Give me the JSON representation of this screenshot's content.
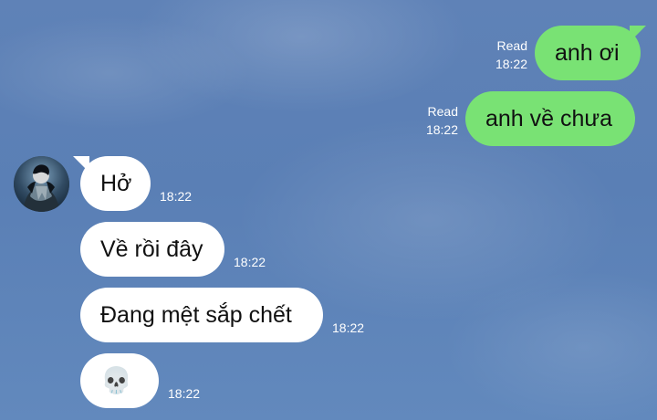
{
  "messages": {
    "outgoing": [
      {
        "status": "Read",
        "time": "18:22",
        "text": "anh ơi"
      },
      {
        "status": "Read",
        "time": "18:22",
        "text": "anh về chưa"
      }
    ],
    "incoming": [
      {
        "time": "18:22",
        "text": "Hở"
      },
      {
        "time": "18:22",
        "text": "Về rồi đây"
      },
      {
        "time": "18:22",
        "text": "Đang mệt sắp chết"
      },
      {
        "time": "18:22",
        "text": "💀"
      }
    ]
  },
  "avatar": {
    "icon": "profile-avatar"
  },
  "colors": {
    "outgoing_bubble": "#79e274",
    "incoming_bubble": "#ffffff",
    "background": "#5a7fb5",
    "meta_text": "#ffffff"
  }
}
